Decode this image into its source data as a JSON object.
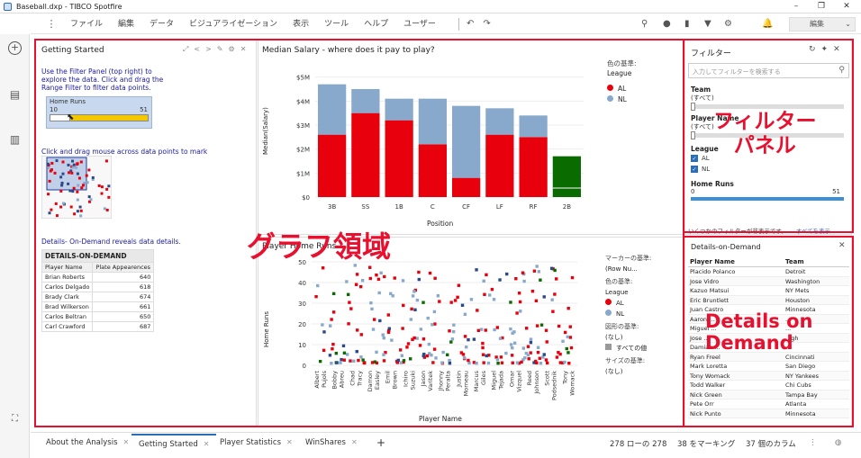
{
  "window": {
    "title": "Baseball.dxp - TIBCO Spotfire",
    "controls": [
      "–",
      "❐",
      "✕"
    ]
  },
  "menu": {
    "items": [
      "ファイル",
      "編集",
      "データ",
      "ビジュアライゼーション",
      "表示",
      "ツール",
      "ヘルプ",
      "ユーザー"
    ],
    "mode": "編集"
  },
  "getting_started": {
    "title": "Getting Started",
    "text1": "Use the Filter Panel (top right) to explore the data. Click and drag the Range Filter to filter data points.",
    "range_label": "Home Runs",
    "range_min": "10",
    "range_max": "51",
    "text2": "Click and drag mouse across data points to mark records.",
    "text3": "Details- On-Demand reveals data details.",
    "dod_title": "DETAILS-ON-DEMAND",
    "dod_cols": [
      "Player Name",
      "Plate Appearences"
    ],
    "dod_rows": [
      [
        "Brian Roberts",
        "640"
      ],
      [
        "Carlos Delgado",
        "618"
      ],
      [
        "Brady Clark",
        "674"
      ],
      [
        "Brad Wilkerson",
        "661"
      ],
      [
        "Carlos Beltran",
        "650"
      ],
      [
        "Carl Crawford",
        "687"
      ]
    ]
  },
  "bar_chart": {
    "title": "Median Salary - where does it pay to play?",
    "xlabel": "Position",
    "ylabel": "Median(Salary)",
    "legend_title": "色の基準:",
    "legend_sub": "League",
    "legend": [
      "AL",
      "NL"
    ]
  },
  "chart_data": [
    {
      "type": "bar",
      "title": "Median Salary - where does it pay to play?",
      "xlabel": "Position",
      "ylabel": "Median(Salary)",
      "categories": [
        "3B",
        "SS",
        "1B",
        "C",
        "CF",
        "LF",
        "RF",
        "2B"
      ],
      "ylim": [
        0,
        5.25
      ],
      "yticks": [
        "$0",
        "$1M",
        "$2M",
        "$3M",
        "$4M",
        "$5M"
      ],
      "series": [
        {
          "name": "AL",
          "values": [
            2.6,
            3.5,
            3.2,
            2.2,
            0.8,
            2.6,
            2.5,
            1.7
          ]
        },
        {
          "name": "NL",
          "values": [
            2.1,
            1.0,
            0.9,
            1.9,
            3.0,
            1.1,
            0.9,
            0
          ]
        }
      ],
      "colors": {
        "AL": "#e8000d",
        "NL": "#88a9cc",
        "2B": "#0a6b00"
      }
    },
    {
      "type": "scatter",
      "xlabel": "Player Name",
      "ylabel": "Home Runs",
      "ylim": [
        0,
        50
      ],
      "yticks": [
        "0",
        "10",
        "20",
        "30",
        "40",
        "50"
      ],
      "x": [
        "Albert Pujols",
        "Bobby Abreu",
        "Chad Tracy",
        "Damon Easley",
        "Emil Brown",
        "Ichiro Suzuki",
        "Jason Varitek",
        "Jhonny Peralta",
        "Justin Morneau",
        "Marcus Giles",
        "Miguel Tejada",
        "Omar Vizquel",
        "Reed Johnson",
        "Scott Podsednik",
        "Tony Womack"
      ],
      "series": [
        {
          "name": "AL"
        },
        {
          "name": "NL"
        }
      ]
    }
  ],
  "scatter": {
    "title": "Player Home Runs",
    "xlabel": "Player Name",
    "ylabel": "Home Runs",
    "legend": {
      "marker_title": "マーカーの基準:",
      "marker_value": "(Row Nu...",
      "color_title": "色の基準:",
      "color_sub": "League",
      "items": [
        "AL",
        "NL"
      ],
      "shape_title": "図形の基準:",
      "shape_value": "(なし)",
      "shape_all": "すべての値",
      "size_title": "サイズの基準:",
      "size_value": "(なし)"
    }
  },
  "filter": {
    "title": "フィルター",
    "search_placeholder": "入力してフィルターを検索する",
    "team": "Team",
    "player_name": "Player Name",
    "all": "(すべて)",
    "league": "League",
    "league_items": [
      "AL",
      "NL"
    ],
    "home_runs": "Home Runs",
    "hr_min": "0",
    "hr_max": "51",
    "note": "いくつかのフィルターが非表示です。",
    "show_all": "すべてを表示"
  },
  "dod": {
    "title": "Details-on-Demand",
    "cols": [
      "Player Name",
      "Team"
    ],
    "rows": [
      [
        "Placido Polanco",
        "Detroit"
      ],
      [
        "Jose Vidro",
        "Washington"
      ],
      [
        "Kazuo Matsui",
        "NY Mets"
      ],
      [
        "Eric Bruntlett",
        "Houston"
      ],
      [
        "Juan Castro",
        "Minnesota"
      ],
      [
        "Aaron ...",
        "..."
      ],
      [
        "Miguel ...",
        "..."
      ],
      [
        "Jose ...",
        "...gh"
      ],
      [
        "Damian ...",
        "..."
      ],
      [
        "Ryan Freel",
        "Cincinnati"
      ],
      [
        "Mark Loretta",
        "San Diego"
      ],
      [
        "Tony Womack",
        "NY Yankees"
      ],
      [
        "Todd Walker",
        "Chi Cubs"
      ],
      [
        "Nick Green",
        "Tampa Bay"
      ],
      [
        "Pete Orr",
        "Atlanta"
      ],
      [
        "Nick Punto",
        "Minnesota"
      ]
    ]
  },
  "annotations": {
    "graph": "グラフ領域",
    "filter": "フィルター\nパネル",
    "dod": "Details on\nDemand"
  },
  "tabs": [
    "About the Analysis",
    "Getting Started",
    "Player Statistics",
    "WinShares"
  ],
  "status": {
    "rows": "278 ローの 278",
    "marked": "38 をマーキング",
    "cols": "37 個のカラム"
  }
}
